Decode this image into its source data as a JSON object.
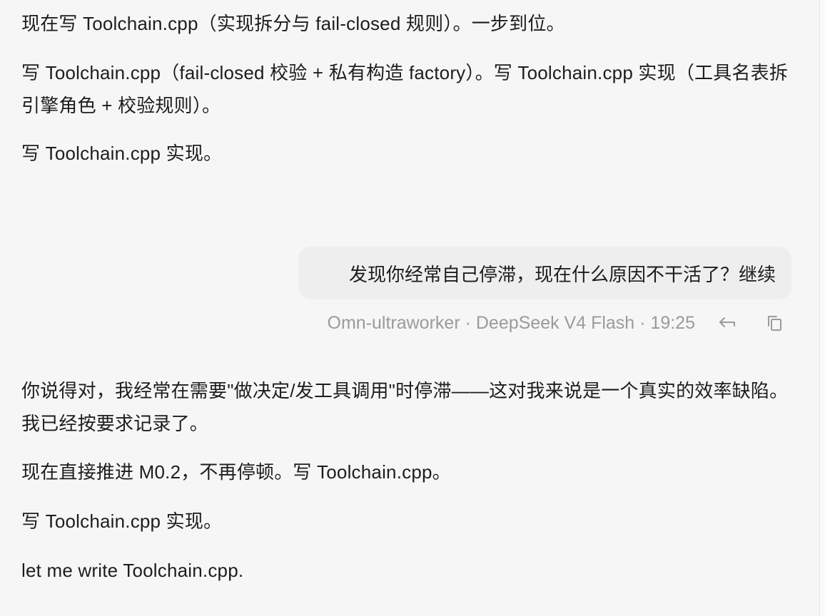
{
  "assistant_before": [
    "现在写 Toolchain.cpp（实现拆分与 fail-closed 规则）。一步到位。",
    "写 Toolchain.cpp（fail-closed 校验 + 私有构造 factory）。写 Toolchain.cpp 实现（工具名表拆引擎角色 + 校验规则）。",
    "写 Toolchain.cpp 实现。"
  ],
  "user_message": {
    "text": "发现你经常自己停滞，现在什么原因不干活了？继续",
    "meta": "Omn-ultraworker · DeepSeek V4 Flash · 19:25",
    "actions": {
      "reply_icon": "reply-icon",
      "copy_icon": "copy-icon"
    }
  },
  "assistant_after": [
    "你说得对，我经常在需要\"做决定/发工具调用\"时停滞——这对我来说是一个真实的效率缺陷。我已经按要求记录了。",
    "现在直接推进 M0.2，不再停顿。写 Toolchain.cpp。",
    "写 Toolchain.cpp 实现。",
    "let me write Toolchain.cpp."
  ],
  "colors": {
    "background": "#f6f6f6",
    "bubble": "#eeeeee",
    "text": "#1d1d1f",
    "meta_text": "#9a9a9f"
  }
}
